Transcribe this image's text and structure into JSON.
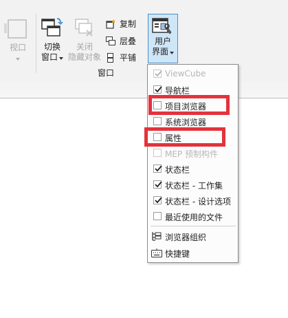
{
  "ribbon": {
    "view_label": "视口",
    "switch_window_label": [
      "切换",
      "窗口"
    ],
    "close_hidden_label": [
      "关闭",
      "隐藏对象"
    ],
    "copy_label": "复制",
    "cascade_label": "层叠",
    "tile_label": "平铺",
    "panel_window_label": "窗口",
    "user_interface_label": [
      "用户",
      "界面"
    ]
  },
  "menu": {
    "items": [
      {
        "label": "ViewCube",
        "checked": true,
        "disabled": true
      },
      {
        "label": "导航栏",
        "checked": true,
        "disabled": false
      },
      {
        "label": "项目浏览器",
        "checked": false,
        "disabled": false
      },
      {
        "label": "系统浏览器",
        "checked": false,
        "disabled": false
      },
      {
        "label": "属性",
        "checked": false,
        "disabled": false
      },
      {
        "label": "MEP 预制构件",
        "checked": false,
        "disabled": true
      },
      {
        "label": "状态栏",
        "checked": true,
        "disabled": false
      },
      {
        "label": "状态栏 - 工作集",
        "checked": true,
        "disabled": false
      },
      {
        "label": "状态栏 - 设计选项",
        "checked": true,
        "disabled": false
      },
      {
        "label": "最近使用的文件",
        "checked": false,
        "disabled": false
      }
    ],
    "browser_org_label": "浏览器组织",
    "shortcut_label": "快捷键"
  },
  "colors": {
    "highlight": "#e3323c",
    "ribbon_bg": "#f2f2f2",
    "active_btn": "#cfe6f7"
  }
}
